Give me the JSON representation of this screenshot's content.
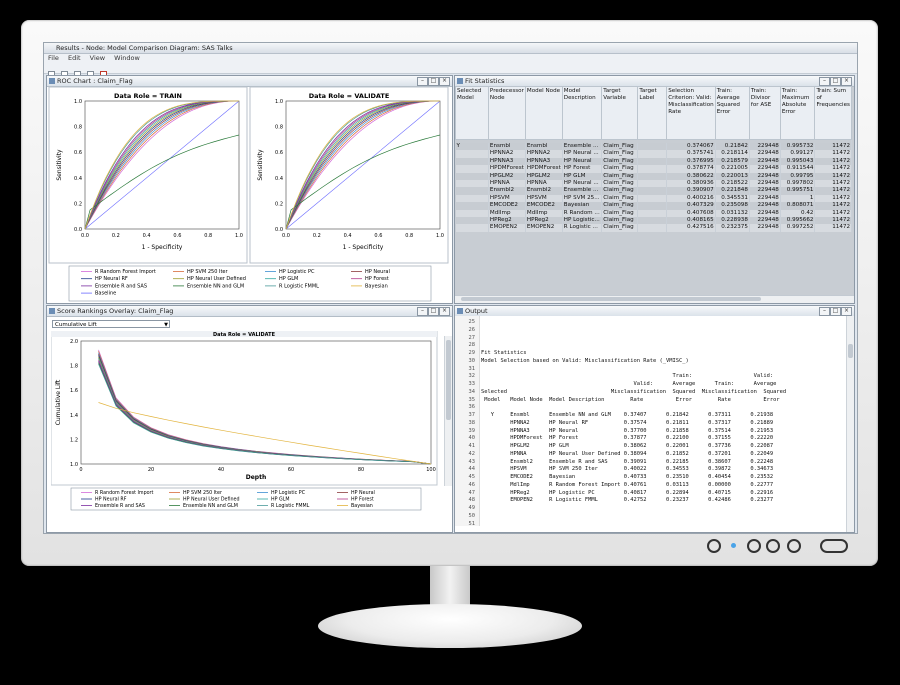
{
  "window": {
    "title": "Results - Node: Model Comparison  Diagram: SAS Talks",
    "menu": [
      "File",
      "Edit",
      "View",
      "Window"
    ]
  },
  "roc": {
    "window_title": "ROC Chart : Claim_Flag",
    "left_title": "Data Role = TRAIN",
    "right_title": "Data Role = VALIDATE",
    "ylabel": "Sensitivity",
    "xlabel": "1 - Specificity",
    "ticks": [
      "0.0",
      "0.2",
      "0.4",
      "0.6",
      "0.8",
      "1.0"
    ]
  },
  "legend_items": [
    "R Random Forest Import",
    "HP SVM 250 Iter",
    "HP Logistic PC",
    "HP Neural",
    "HP Neural RF",
    "HP Neural User Defined",
    "HP GLM",
    "HP Forest",
    "Ensemble R and SAS",
    "Ensemble NN and GLM",
    "R Logistic FMML",
    "Bayesian",
    "Baseline"
  ],
  "legend_colors": [
    "#d26ad8",
    "#d76b3a",
    "#3b8fd1",
    "#8b3b3b",
    "#1e3a8a",
    "#9c9c2b",
    "#2fa7a0",
    "#b23a8a",
    "#7a2da0",
    "#2a7a3a",
    "#4a9a9a",
    "#e2b33c",
    "#6a6aff"
  ],
  "fit": {
    "window_title": "Fit Statistics",
    "headers": [
      "Selected Model",
      "Predecessor Node",
      "Model Node",
      "Model Description",
      "Target Variable",
      "Target Label",
      "Selection Criterion: Valid: Misclassification Rate",
      "Train: Average Squared Error",
      "Train: Divisor for ASE",
      "Train: Maximum Absolute Error",
      "Train: Sum of Frequencies"
    ],
    "rows": [
      [
        "Y",
        "Ensmbl",
        "Ensmbl",
        "Ensemble ...",
        "Claim_Flag",
        "",
        "0.374067",
        "0.21842",
        "229448",
        "0.995732",
        "11472"
      ],
      [
        "",
        "HPNNA2",
        "HPNNA2",
        "HP Neural ...",
        "Claim_Flag",
        "",
        "0.375741",
        "0.218114",
        "229448",
        "0.99127",
        "11472"
      ],
      [
        "",
        "HPNNA3",
        "HPNNA3",
        "HP Neural",
        "Claim_Flag",
        "",
        "0.376995",
        "0.218579",
        "229448",
        "0.995043",
        "11472"
      ],
      [
        "",
        "HPDMForest",
        "HPDMForest",
        "HP Forest",
        "Claim_Flag",
        "",
        "0.378774",
        "0.221005",
        "229448",
        "0.911544",
        "11472"
      ],
      [
        "",
        "HPGLM2",
        "HPGLM2",
        "HP GLM",
        "Claim_Flag",
        "",
        "0.380622",
        "0.220013",
        "229448",
        "0.99795",
        "11472"
      ],
      [
        "",
        "HPNNA",
        "HPNNA",
        "HP Neural ...",
        "Claim_Flag",
        "",
        "0.380936",
        "0.218522",
        "229448",
        "0.997802",
        "11472"
      ],
      [
        "",
        "Ensmbl2",
        "Ensmbl2",
        "Ensemble ...",
        "Claim_Flag",
        "",
        "0.390907",
        "0.221848",
        "229448",
        "0.995751",
        "11472"
      ],
      [
        "",
        "HPSVM",
        "HPSVM",
        "HP SVM 25...",
        "Claim_Flag",
        "",
        "0.400216",
        "0.345531",
        "229448",
        "1",
        "11472"
      ],
      [
        "",
        "EMCODE2",
        "EMCODE2",
        "Bayesian",
        "Claim_Flag",
        "",
        "0.407329",
        "0.235098",
        "229448",
        "0.808071",
        "11472"
      ],
      [
        "",
        "MdlImp",
        "MdlImp",
        "R Random ...",
        "Claim_Flag",
        "",
        "0.407608",
        "0.031132",
        "229448",
        "0.42",
        "11472"
      ],
      [
        "",
        "HPReg2",
        "HPReg2",
        "HP Logistic...",
        "Claim_Flag",
        "",
        "0.408165",
        "0.228938",
        "229448",
        "0.995662",
        "11472"
      ],
      [
        "",
        "EMOPEN2",
        "EMOPEN2",
        "R Logistic ...",
        "Claim_Flag",
        "",
        "0.427516",
        "0.232375",
        "229448",
        "0.997252",
        "11472"
      ]
    ]
  },
  "score": {
    "window_title": "Score Rankings Overlay: Claim_Flag",
    "dropdown": "Cumulative Lift",
    "title": "Data Role = VALIDATE",
    "ylabel": "Cumulative Lift",
    "xlabel": "Depth",
    "yticks": [
      "1.0",
      "1.2",
      "1.4",
      "1.6",
      "1.8",
      "2.0"
    ],
    "xticks": [
      "0",
      "20",
      "40",
      "60",
      "80",
      "100"
    ]
  },
  "output": {
    "window_title": "Output",
    "lines": [
      [
        "25",
        ""
      ],
      [
        "26",
        ""
      ],
      [
        "27",
        ""
      ],
      [
        "28",
        ""
      ],
      [
        "29",
        "Fit Statistics"
      ],
      [
        "30",
        "Model Selection based on Valid: Misclassification Rate (_VMISC_)"
      ],
      [
        "31",
        ""
      ],
      [
        "32",
        "                                                           Train:                   Valid:"
      ],
      [
        "33",
        "                                               Valid:      Average      Train:      Average"
      ],
      [
        "34",
        "Selected                                Misclassification  Squared  Misclassification  Squared"
      ],
      [
        "35",
        " Model   Model Node  Model Description        Rate          Error        Rate          Error"
      ],
      [
        "36",
        ""
      ],
      [
        "37",
        "   Y     Ensmbl      Ensemble NN and GLM    0.37407      0.21842      0.37311      0.21938"
      ],
      [
        "38",
        "         HPNNA2      HP Neural RF           0.37574      0.21811      0.37317      0.21889"
      ],
      [
        "39",
        "         HPNNA3      HP Neural              0.37700      0.21858      0.37514      0.21953"
      ],
      [
        "40",
        "         HPDMForest  HP Forest              0.37877      0.22100      0.37155      0.22220"
      ],
      [
        "41",
        "         HPGLM2      HP GLM                 0.38062      0.22001      0.37736      0.22087"
      ],
      [
        "42",
        "         HPNNA       HP Neural User Defined 0.38094      0.21852      0.37201      0.22049"
      ],
      [
        "43",
        "         Ensmbl2     Ensemble R and SAS     0.39091      0.22185      0.38607      0.22248"
      ],
      [
        "44",
        "         HPSVM       HP SVM 250 Iter        0.40022      0.34553      0.39872      0.34673"
      ],
      [
        "45",
        "         EMCODE2     Bayesian               0.40733      0.23510      0.40454      0.23532"
      ],
      [
        "46",
        "         MdlImp      R Random Forest Import 0.40761      0.03113      0.00000      0.22777"
      ],
      [
        "47",
        "         HPReg2      HP Logistic PC         0.40817      0.22894      0.40715      0.22916"
      ],
      [
        "48",
        "         EMOPEN2     R Logistic FMML        0.42752      0.23237      0.42486      0.23277"
      ],
      [
        "49",
        ""
      ],
      [
        "50",
        ""
      ],
      [
        "51",
        ""
      ]
    ]
  }
}
